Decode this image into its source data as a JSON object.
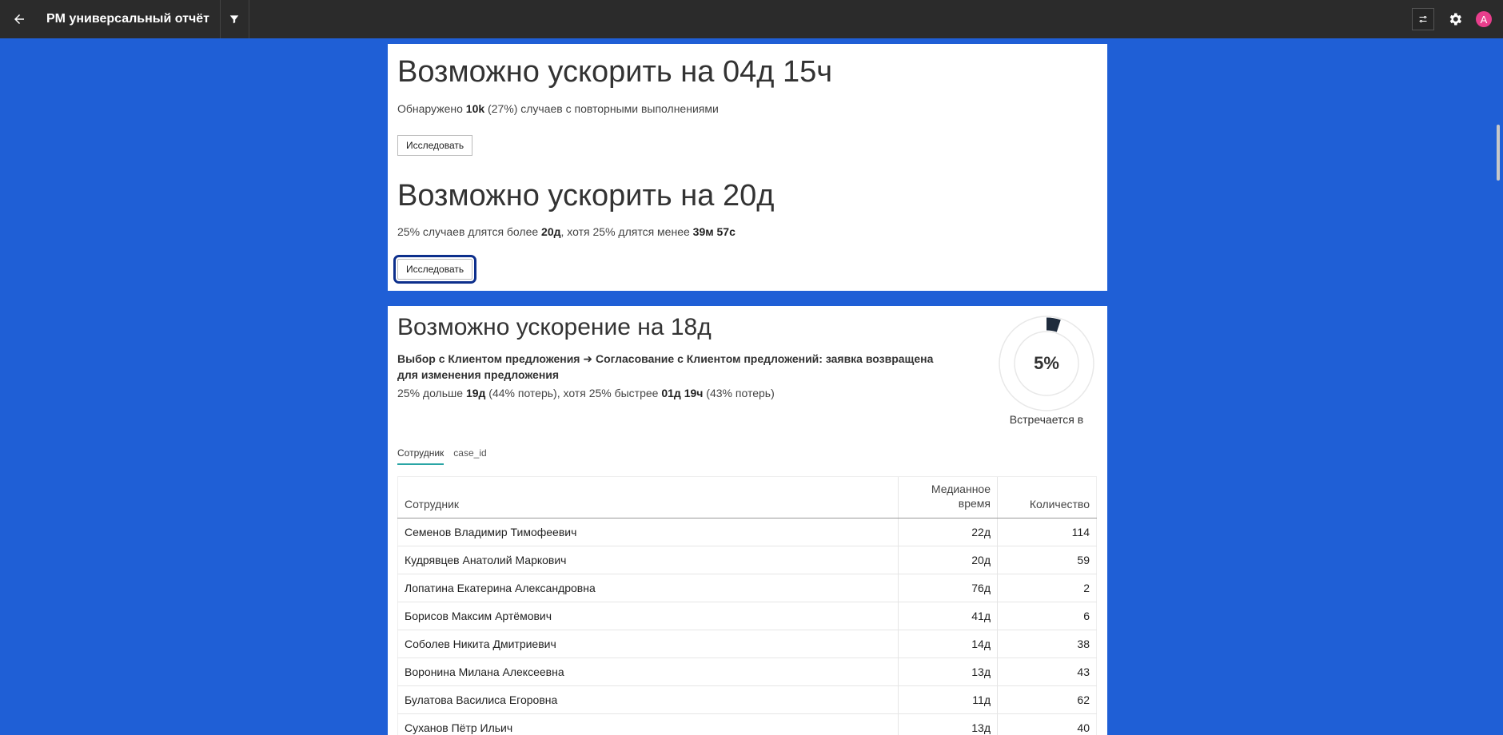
{
  "header": {
    "title": "PM универсальный отчёт",
    "avatar_letter": "A",
    "icons": [
      "arrow-back-icon",
      "filter-icon",
      "tune-icon",
      "gear-icon"
    ]
  },
  "card1": {
    "block1": {
      "title": "Возможно ускорить на 04д 15ч",
      "text_pre": "Обнаружено ",
      "count": "10k",
      "text_post": " (27%) случаев с повторными выполнениями",
      "button": "Исследовать"
    },
    "block2": {
      "title": "Возможно ускорить на 20д",
      "text_pre": "25% случаев длятся более ",
      "long": "20д",
      "text_mid": ", хотя 25% длятся менее ",
      "short": "39м 57с",
      "button": "Исследовать"
    }
  },
  "card2": {
    "title": "Возможно ускорение на 18д",
    "transition": "Выбор с Клиентом предложения ➜ Согласование с Клиентом предложений: заявка возвращена для изменения предложения",
    "delta_pre": "25% дольше ",
    "slow": "19д",
    "delta_mid": " (44% потерь), хотя 25% быстрее ",
    "fast": "01д 19ч",
    "delta_post": " (43% потерь)",
    "donut": {
      "percent_label": "5%",
      "fraction": 0.05,
      "caption": "Встречается в"
    },
    "tabs": [
      "Сотрудник",
      "case_id"
    ],
    "table": {
      "headers": [
        "Сотрудник",
        "Медианное время",
        "Количество"
      ],
      "rows": [
        [
          "Семенов Владимир Тимофеевич",
          "22д",
          "114"
        ],
        [
          "Кудрявцев Анатолий Маркович",
          "20д",
          "59"
        ],
        [
          "Лопатина Екатерина Александровна",
          "76д",
          "2"
        ],
        [
          "Борисов Максим Артёмович",
          "41д",
          "6"
        ],
        [
          "Соболев Никита Дмитриевич",
          "14д",
          "38"
        ],
        [
          "Воронина Милана Алексеевна",
          "13д",
          "43"
        ],
        [
          "Булатова Василиса Егоровна",
          "11д",
          "62"
        ],
        [
          "Суханов Пётр Ильич",
          "13д",
          "40"
        ]
      ]
    }
  },
  "colors": {
    "background": "#1f5fd6",
    "topbar": "#2b2b2b",
    "avatar": "#e83e8c",
    "tab_underline": "#2aa5a5",
    "donut_fill": "#1e2b3c"
  }
}
